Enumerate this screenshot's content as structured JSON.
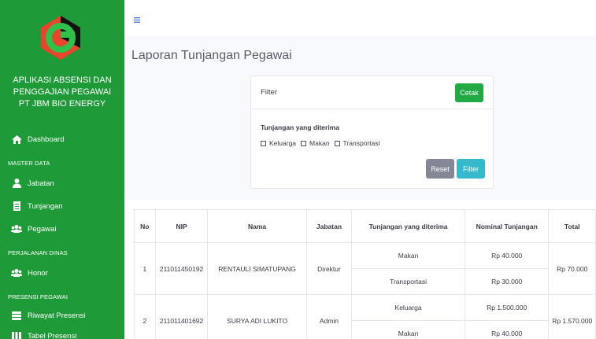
{
  "sidebar": {
    "brand_line1": "APLIKASI ABSENSI DAN",
    "brand_line2": "PENGGAJIAN PEGAWAI",
    "brand_line3": "PT JBM BIO ENERGY",
    "dashboard": "Dashboard",
    "master_data": "MASTER DATA",
    "jabatan": "Jabatan",
    "tunjangan": "Tunjangan",
    "pegawai": "Pegawai",
    "perjalanan_dinas": "PERJALANAN DINAS",
    "honor": "Honor",
    "presensi_pegawai": "PRESENSI PEGAWAI",
    "riwayat_presensi": "Riwayat Presensi",
    "tabel_presensi": "Tabel Presensi"
  },
  "page": {
    "title": "Laporan Tunjangan Pegawai"
  },
  "filter": {
    "title": "Filter",
    "cetak": "Cetak",
    "label": "Tunjangan yang diterima",
    "options": [
      "Keluarga",
      "Makan",
      "Transportasi"
    ],
    "reset": "Reset",
    "filter": "Filter"
  },
  "table": {
    "headers": [
      "No",
      "NIP",
      "Nama",
      "Jabatan",
      "Tunjangan yang diterima",
      "Nominal Tunjangan",
      "Total"
    ],
    "rows": [
      {
        "no": "1",
        "nip": "211011450192",
        "nama": "RENTAULI SIMATUPANG",
        "jabatan": "Direktur",
        "items": [
          {
            "tunjangan": "Makan",
            "nominal": "Rp 40.000"
          },
          {
            "tunjangan": "Transportasi",
            "nominal": "Rp 30.000"
          }
        ],
        "total": "Rp 70.000"
      },
      {
        "no": "2",
        "nip": "211011401692",
        "nama": "SURYA ADI LUKITO",
        "jabatan": "Admin",
        "items": [
          {
            "tunjangan": "Keluarga",
            "nominal": "Rp 1.500.000"
          },
          {
            "tunjangan": "Makan",
            "nominal": "Rp 40.000"
          }
        ],
        "total": "Rp 1.570.000"
      }
    ]
  },
  "colors": {
    "sidebar": "#1f9a38",
    "accent_green": "#21a944",
    "accent_cyan": "#36b9cc"
  }
}
